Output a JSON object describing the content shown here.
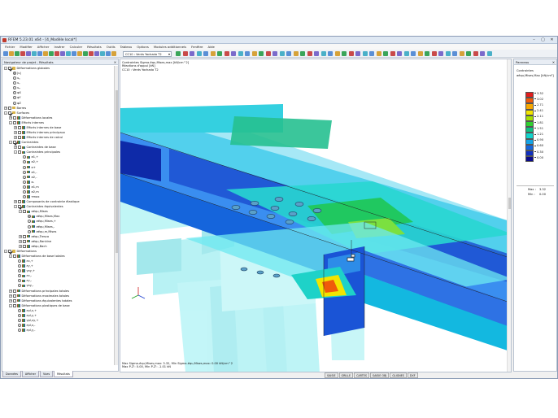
{
  "app": {
    "title": "RFEM 5.23.01 x64 - [4_Modèle local*]"
  },
  "menu": [
    "Fichier",
    "Modifier",
    "Afficher",
    "Insérer",
    "Calculer",
    "Résultats",
    "Outils",
    "Tableau",
    "Options",
    "Modules additionnels",
    "Fenêtre",
    "Aide"
  ],
  "toolbar": {
    "load_case": "CC10 : Vents Yachada T2"
  },
  "navigator": {
    "title": "Navigateur de projet - Résultats",
    "tabs": [
      "Données",
      "Afficher",
      "Vues",
      "Résultats"
    ],
    "active_tab": "Résultats",
    "items": [
      {
        "level": 0,
        "expander": "-",
        "box": "cb-on",
        "icon": "fol",
        "label": "Déformations globales"
      },
      {
        "level": 1,
        "expander": "",
        "box": "rd-on",
        "icon": "",
        "label": "|u|"
      },
      {
        "level": 1,
        "expander": "",
        "box": "rd",
        "icon": "",
        "label": "uᵪ"
      },
      {
        "level": 1,
        "expander": "",
        "box": "rd",
        "icon": "",
        "label": "uᵧ"
      },
      {
        "level": 1,
        "expander": "",
        "box": "rd",
        "icon": "",
        "label": "uᵩ"
      },
      {
        "level": 1,
        "expander": "",
        "box": "rd",
        "icon": "",
        "label": "φX"
      },
      {
        "level": 1,
        "expander": "",
        "box": "rd",
        "icon": "",
        "label": "φY"
      },
      {
        "level": 1,
        "expander": "",
        "box": "rd",
        "icon": "",
        "label": "φZ"
      },
      {
        "level": 0,
        "expander": "+",
        "box": "cb",
        "icon": "fol",
        "label": "Barres"
      },
      {
        "level": 0,
        "expander": "-",
        "box": "cb-on",
        "icon": "fol",
        "label": "Surfaces"
      },
      {
        "level": 1,
        "expander": "+",
        "box": "cb",
        "icon": "res",
        "label": "Déformations locales"
      },
      {
        "level": 1,
        "expander": "-",
        "box": "cb",
        "icon": "res",
        "label": "Efforts internes"
      },
      {
        "level": 2,
        "expander": "+",
        "box": "cb",
        "icon": "res",
        "label": "Efforts internes de base"
      },
      {
        "level": 2,
        "expander": "+",
        "box": "cb",
        "icon": "res",
        "label": "Efforts internes principaux"
      },
      {
        "level": 2,
        "expander": "+",
        "box": "cb",
        "icon": "res",
        "label": "Efforts internes de calcul"
      },
      {
        "level": 1,
        "expander": "-",
        "box": "cb-on",
        "icon": "res",
        "label": "Contraintes"
      },
      {
        "level": 2,
        "expander": "+",
        "box": "cb",
        "icon": "res",
        "label": "Contraintes de base"
      },
      {
        "level": 2,
        "expander": "-",
        "box": "cb",
        "icon": "res",
        "label": "Contraintes principales"
      },
      {
        "level": 3,
        "expander": "",
        "box": "rd",
        "icon": "res",
        "label": "σ1,+"
      },
      {
        "level": 3,
        "expander": "",
        "box": "rd",
        "icon": "res",
        "label": "σ2,+"
      },
      {
        "level": 3,
        "expander": "",
        "box": "rd",
        "icon": "res",
        "label": "α+"
      },
      {
        "level": 3,
        "expander": "",
        "box": "rd",
        "icon": "res",
        "label": "σ1,-"
      },
      {
        "level": 3,
        "expander": "",
        "box": "rd",
        "icon": "res",
        "label": "σ2,-"
      },
      {
        "level": 3,
        "expander": "",
        "box": "rd",
        "icon": "res",
        "label": "α-"
      },
      {
        "level": 3,
        "expander": "",
        "box": "rd",
        "icon": "res",
        "label": "σ1,m"
      },
      {
        "level": 3,
        "expander": "",
        "box": "rd",
        "icon": "res",
        "label": "σ2,m"
      },
      {
        "level": 3,
        "expander": "",
        "box": "rd",
        "icon": "res",
        "label": "τmax"
      },
      {
        "level": 2,
        "expander": "+",
        "box": "cb",
        "icon": "res",
        "label": "Composants de contrainte élastique"
      },
      {
        "level": 2,
        "expander": "-",
        "box": "cb-on",
        "icon": "res",
        "label": "Contraintes équivalentes"
      },
      {
        "level": 3,
        "expander": "-",
        "box": "cb",
        "icon": "res",
        "label": "σéqu,Mises"
      },
      {
        "level": 4,
        "expander": "",
        "box": "rd-on",
        "icon": "res",
        "label": "σéqu,Mises,Max"
      },
      {
        "level": 4,
        "expander": "",
        "box": "rd",
        "icon": "res",
        "label": "σéqu,Mises,+"
      },
      {
        "level": 4,
        "expander": "",
        "box": "rd",
        "icon": "res",
        "label": "σéqu,Mises,-"
      },
      {
        "level": 4,
        "expander": "",
        "box": "rd",
        "icon": "res",
        "label": "σéqu,m,Mises"
      },
      {
        "level": 3,
        "expander": "+",
        "box": "cb",
        "icon": "res",
        "label": "σéqu,Tresca"
      },
      {
        "level": 3,
        "expander": "+",
        "box": "cb",
        "icon": "res",
        "label": "σéqu,Rankine"
      },
      {
        "level": 3,
        "expander": "+",
        "box": "cb",
        "icon": "res",
        "label": "σéqu,Bach"
      },
      {
        "level": 0,
        "expander": "-",
        "box": "cb-on",
        "icon": "fol",
        "label": "Déformations"
      },
      {
        "level": 1,
        "expander": "-",
        "box": "cb",
        "icon": "res",
        "label": "Déformations de base totales"
      },
      {
        "level": 2,
        "expander": "",
        "box": "rd",
        "icon": "res",
        "label": "εx,+"
      },
      {
        "level": 2,
        "expander": "",
        "box": "rd",
        "icon": "res",
        "label": "εy,+"
      },
      {
        "level": 2,
        "expander": "",
        "box": "rd",
        "icon": "res",
        "label": "γxy,+"
      },
      {
        "level": 2,
        "expander": "",
        "box": "rd",
        "icon": "res",
        "label": "εx,-"
      },
      {
        "level": 2,
        "expander": "",
        "box": "rd",
        "icon": "res",
        "label": "εy,-"
      },
      {
        "level": 2,
        "expander": "",
        "box": "rd",
        "icon": "res",
        "label": "γxy,-"
      },
      {
        "level": 1,
        "expander": "+",
        "box": "cb",
        "icon": "res",
        "label": "Déformations principales totales"
      },
      {
        "level": 1,
        "expander": "+",
        "box": "cb",
        "icon": "res",
        "label": "Déformations maximales totales"
      },
      {
        "level": 1,
        "expander": "+",
        "box": "cb",
        "icon": "res",
        "label": "Déformations équivalentes totales"
      },
      {
        "level": 1,
        "expander": "-",
        "box": "cb",
        "icon": "res",
        "label": "Déformations plastiques de base"
      },
      {
        "level": 2,
        "expander": "",
        "box": "rd",
        "icon": "res",
        "label": "εpl,x,+"
      },
      {
        "level": 2,
        "expander": "",
        "box": "rd",
        "icon": "res",
        "label": "εpl,y,+"
      },
      {
        "level": 2,
        "expander": "",
        "box": "rd",
        "icon": "res",
        "label": "γpl,xy,+"
      },
      {
        "level": 2,
        "expander": "",
        "box": "rd",
        "icon": "res",
        "label": "εpl,x,-"
      },
      {
        "level": 2,
        "expander": "",
        "box": "rd",
        "icon": "res",
        "label": "εpl,y,-"
      }
    ]
  },
  "view": {
    "info": [
      "Contraintes Sigma-équ,Mises,max [kN/cm^2]",
      "Réactions d'appui [kN]",
      "CC10 : Vents Yachada T2"
    ],
    "footer": [
      "Max Sigma-équ,Mises,max: 3.32, Min Sigma-équ,Mises,max: 0.00 kN/cm^2",
      "Max P-Z': 0.00, Min P-Z': -1.01 kN"
    ]
  },
  "panel": {
    "title": "Panneau",
    "heading": "Contraintes",
    "quantity": "σéqu,Mises,Max [kN/cm²]",
    "legend_values": [
      "3.32",
      "3.02",
      "2.71",
      "2.41",
      "2.11",
      "1.81",
      "1.51",
      "1.21",
      "0.90",
      "0.60",
      "0.30",
      "0.00"
    ],
    "legend_colors": [
      "#e11d1d",
      "#f05a0a",
      "#f7a800",
      "#f2e400",
      "#a6e000",
      "#2fd12f",
      "#10c080",
      "#12d4cc",
      "#14a4e6",
      "#1566dc",
      "#1030c0",
      "#0a0a8a"
    ],
    "max_label": "Max :",
    "max_value": "3.32",
    "min_label": "Min :",
    "min_value": "0.00"
  },
  "status": [
    "SAISIE",
    "GRILLE",
    "CARTES",
    "SAISIE OBJ",
    "GLIGNES",
    "DXF"
  ]
}
